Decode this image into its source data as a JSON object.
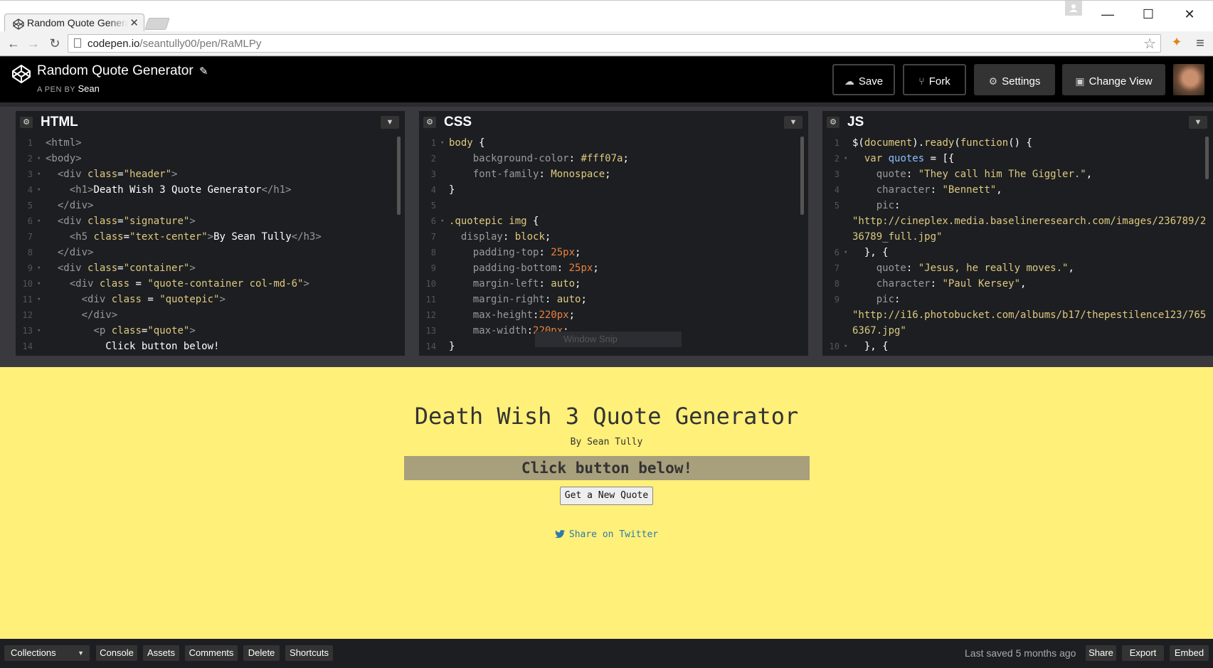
{
  "browser": {
    "tab_title": "Random Quote Generator | CodePen",
    "url_host": "codepen.io",
    "url_path": "/seantully00/pen/RaMLPy"
  },
  "header": {
    "title": "Random Quote Generator",
    "by_label": "A PEN BY",
    "author": "Sean",
    "buttons": {
      "save": "Save",
      "fork": "Fork",
      "settings": "Settings",
      "change_view": "Change View"
    }
  },
  "editors": {
    "html": {
      "title": "HTML",
      "lines": [
        "<html>",
        "<body>",
        "  <div class=\"header\">",
        "    <h1>Death Wish 3 Quote Generator</h1>",
        "  </div>",
        "  <div class=\"signature\">",
        "    <h5 class=\"text-center\">By Sean Tully</h3>",
        "  </div>",
        "  <div class=\"container\">",
        "    <div class = \"quote-container col-md-6\">",
        "      <div class = \"quotepic\">",
        "      </div>",
        "        <p class=\"quote\">",
        "          Click button below!"
      ]
    },
    "css": {
      "title": "CSS",
      "lines": [
        "body {",
        "    background-color: #fff07a;",
        "    font-family: Monospace;",
        "}",
        "",
        ".quotepic img {",
        "  display: block;",
        "    padding-top: 25px;",
        "    padding-bottom: 25px;",
        "    margin-left: auto;",
        "    margin-right: auto;",
        "    max-height:220px;",
        "    max-width:220px;",
        "}"
      ]
    },
    "js": {
      "title": "JS",
      "lines": [
        "$(document).ready(function() {",
        "  var quotes = [{",
        "    quote: \"They call him The Giggler.\",",
        "    character: \"Bennett\",",
        "    pic:",
        "\"http://cineplex.media.baselineresearch.com/images/236789/2",
        "36789_full.jpg\"",
        "  }, {",
        "    quote: \"Jesus, he really moves.\",",
        "    character: \"Paul Kersey\",",
        "    pic:",
        "\"http://i16.photobucket.com/albums/b17/thepestilence123/765",
        "6367.jpg\"",
        "  }, {"
      ],
      "line_numbers": [
        "1",
        "2",
        "3",
        "4",
        "5",
        "",
        "6",
        "7",
        "8",
        "9",
        "",
        "",
        "10"
      ]
    },
    "overlay_text": "Window Snip"
  },
  "preview": {
    "title": "Death Wish 3 Quote Generator",
    "signature": "By Sean Tully",
    "quote": "Click button below!",
    "button": "Get a New Quote",
    "share": "Share on Twitter"
  },
  "footer": {
    "collections": "Collections",
    "console": "Console",
    "assets": "Assets",
    "comments": "Comments",
    "delete": "Delete",
    "shortcuts": "Shortcuts",
    "last_saved": "Last saved 5 months ago",
    "share": "Share",
    "export": "Export",
    "embed": "Embed"
  },
  "colors": {
    "preview_bg": "#fff07a",
    "editor_bg": "#1d1e22",
    "header_bg": "#000000",
    "link": "#2e7ba8"
  }
}
